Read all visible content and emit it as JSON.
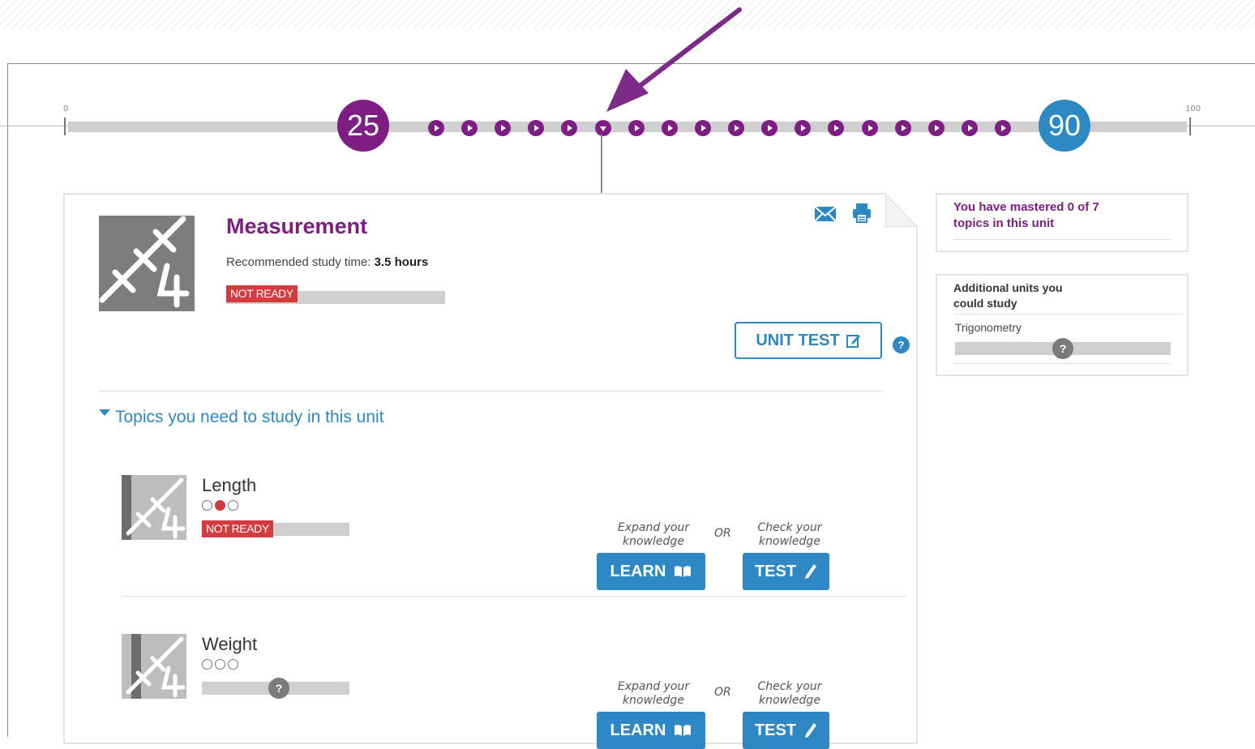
{
  "timeline": {
    "min_label": "0",
    "max_label": "100",
    "current_score": "25",
    "target_score": "90",
    "current_color": "#7e1d84",
    "target_color": "#2d88c4",
    "unit_marker_count": 18,
    "selected_marker": 6
  },
  "unit": {
    "title": "Measurement",
    "study_time_label": "Recommended study time:",
    "study_time_value": "3.5 hours",
    "status": "NOT READY",
    "unit_test_label": "UNIT TEST",
    "help_glyph": "?",
    "icons": {
      "email": "mail-icon",
      "print": "printer-icon",
      "edit": "edit-icon"
    }
  },
  "topics_header": "Topics you need to study in this unit",
  "topics": [
    {
      "name": "Length",
      "level_dots": [
        false,
        true,
        false
      ],
      "status": "NOT READY",
      "hint_learn": "Expand your knowledge",
      "or": "OR",
      "hint_test": "Check your knowledge",
      "learn_label": "LEARN",
      "test_label": "TEST"
    },
    {
      "name": "Weight",
      "level_dots": [
        false,
        false,
        false
      ],
      "status_glyph": "?",
      "hint_learn": "Expand your knowledge",
      "or": "OR",
      "hint_test": "Check your knowledge",
      "learn_label": "LEARN",
      "test_label": "TEST"
    }
  ],
  "mastery": {
    "text": "You have mastered 0 of 7 topics in this unit"
  },
  "additional": {
    "title": "Additional units you could study",
    "items": [
      {
        "name": "Trigonometry",
        "status_glyph": "?"
      }
    ]
  },
  "colors": {
    "purple": "#7e1d84",
    "blue": "#2d88c4",
    "red": "#d33b3e"
  }
}
